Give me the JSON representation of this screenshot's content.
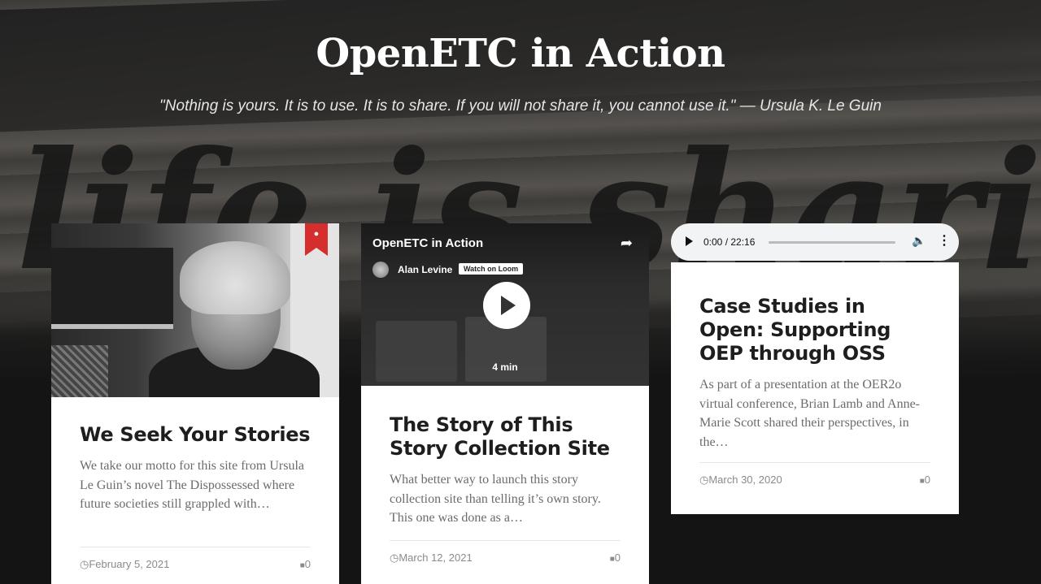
{
  "hero": {
    "title": "OpenETC in Action",
    "quote": "\"Nothing is yours. It is to use. It is to share. If you will not share it, you cannot use it.\" — Ursula K. Le Guin",
    "wall_text": "life is sharing"
  },
  "cards": [
    {
      "title": "We Seek Your Stories",
      "excerpt": "We take our motto for this site from Ursula Le Guin’s novel The Dispossessed where future societies still grappled with…",
      "date": "February 5, 2021",
      "comments": "0",
      "sticky_icon": "pin-icon"
    },
    {
      "title": "The Story of This Story Collection Site",
      "excerpt": "What better way to launch this story collection site than telling it’s own story. This one was done as a…",
      "date": "March 12, 2021",
      "comments": "0",
      "video": {
        "title": "OpenETC in Action",
        "author": "Alan Levine",
        "watch_label": "Watch on Loom",
        "duration": "4 min"
      }
    },
    {
      "title": "Case Studies in Open: Supporting OEP through OSS",
      "excerpt": "As part of a presentation at the  OER2o virtual conference, Brian Lamb and Anne-Marie Scott shared their perspectives, in the…",
      "date": "March 30, 2020",
      "comments": "0",
      "audio": {
        "time": "0:00 / 22:16"
      }
    }
  ]
}
